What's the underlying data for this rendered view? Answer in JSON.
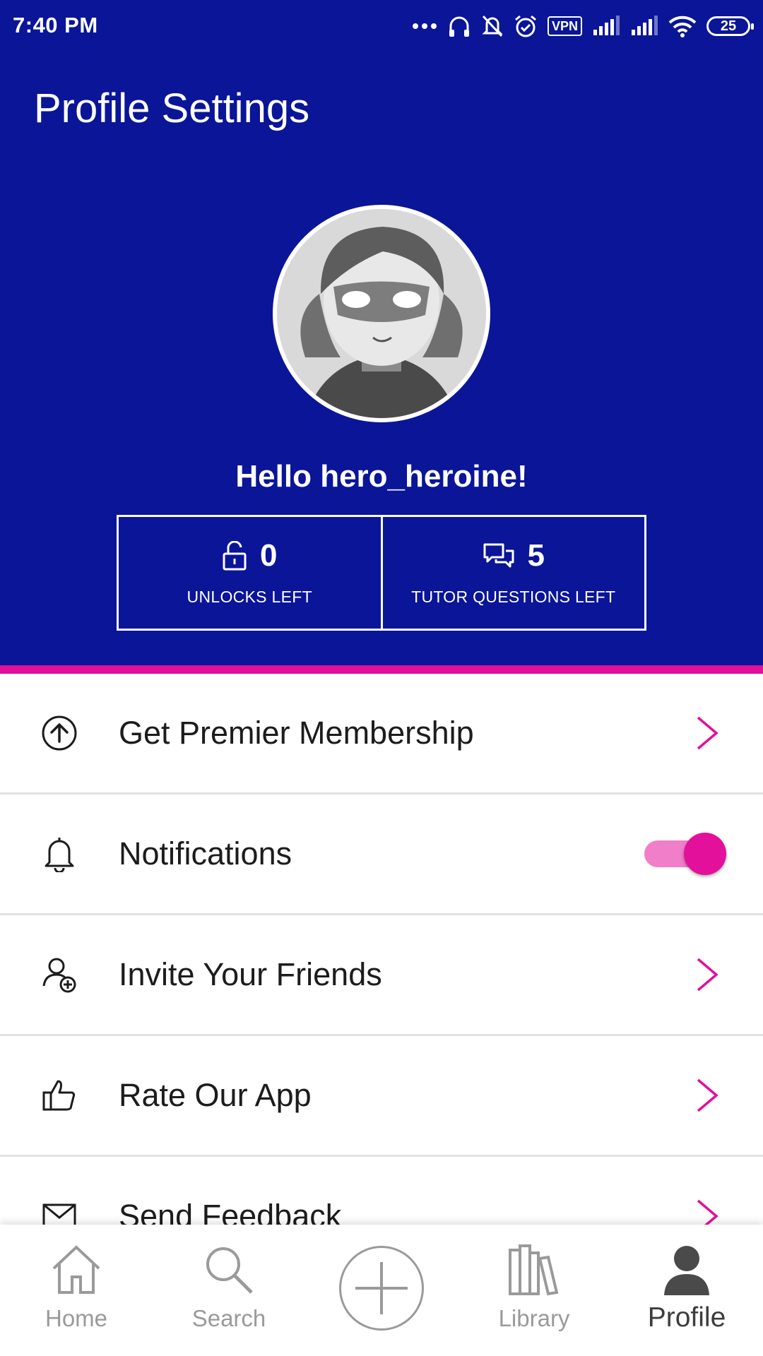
{
  "status_bar": {
    "time": "7:40 PM",
    "vpn": "VPN",
    "battery": "25"
  },
  "header": {
    "title": "Profile Settings",
    "greeting": "Hello hero_heroine!"
  },
  "stats": [
    {
      "value": "0",
      "label": "UNLOCKS LEFT",
      "icon": "unlock-icon"
    },
    {
      "value": "5",
      "label": "TUTOR QUESTIONS LEFT",
      "icon": "chat-bubbles-icon"
    }
  ],
  "menu": {
    "items": [
      {
        "label": "Get Premier Membership",
        "icon": "arrow-up-circle-icon",
        "control": "chevron"
      },
      {
        "label": "Notifications",
        "icon": "bell-icon",
        "control": "toggle",
        "enabled": true
      },
      {
        "label": "Invite Your Friends",
        "icon": "add-friend-icon",
        "control": "chevron"
      },
      {
        "label": "Rate Our App",
        "icon": "thumbs-up-icon",
        "control": "chevron"
      },
      {
        "label": "Send Feedback",
        "icon": "envelope-icon",
        "control": "chevron"
      }
    ]
  },
  "bottom_nav": {
    "items": [
      {
        "label": "Home",
        "icon": "home-icon",
        "active": false
      },
      {
        "label": "Search",
        "icon": "search-icon",
        "active": false
      },
      {
        "label": "",
        "icon": "add-icon",
        "active": false
      },
      {
        "label": "Library",
        "icon": "library-icon",
        "active": false
      },
      {
        "label": "Profile",
        "icon": "profile-icon",
        "active": true
      }
    ]
  },
  "colors": {
    "header_bg": "#0a1597",
    "accent": "#e2109a",
    "toggle_track": "#f07ec8",
    "nav_inactive": "#9a9a9a"
  }
}
